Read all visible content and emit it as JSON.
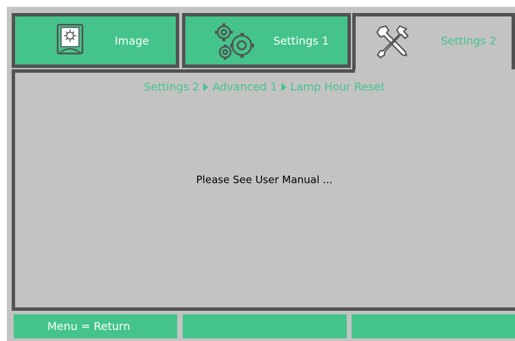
{
  "tabs": [
    {
      "label": "Image",
      "icon": "image-icon",
      "active": false
    },
    {
      "label": "Settings 1",
      "icon": "gears-icon",
      "active": false
    },
    {
      "label": "Settings 2",
      "icon": "tools-icon",
      "active": true
    }
  ],
  "breadcrumb": {
    "items": [
      "Settings 2",
      "Advanced 1",
      "Lamp Hour Reset"
    ]
  },
  "message": "Please See User Manual ...",
  "footer": {
    "buttons": [
      "Menu = Return",
      "",
      ""
    ]
  },
  "colors": {
    "accent_green": "#44c48b",
    "border_dark": "#525252",
    "panel_gray": "#c3c3c3",
    "text_white": "#ffffff"
  }
}
